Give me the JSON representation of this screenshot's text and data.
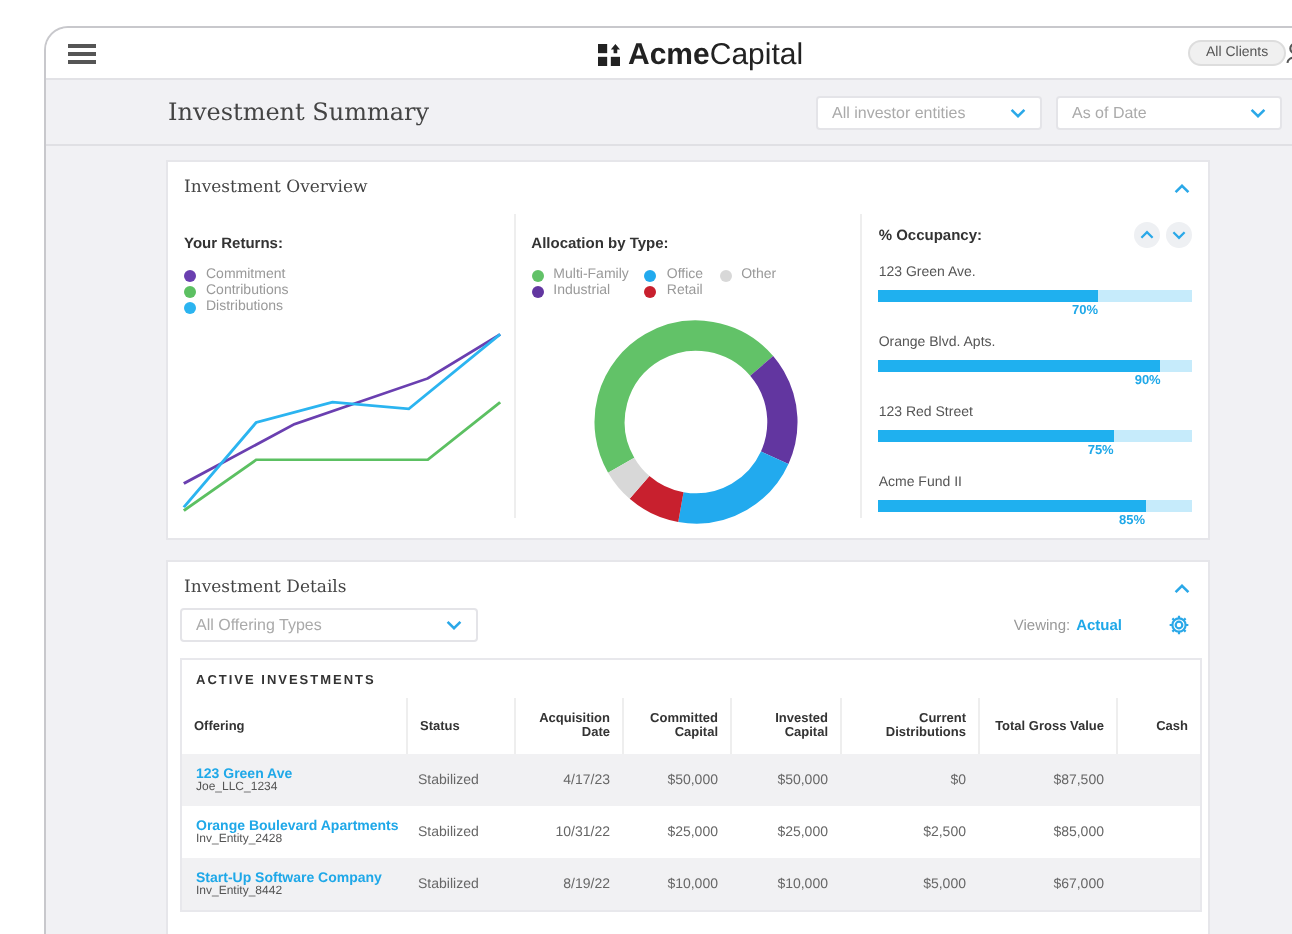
{
  "header": {
    "logo_bold": "Acme",
    "logo_light": "Capital",
    "client_filter": "All Clients"
  },
  "subheader": {
    "title": "Investment Summary",
    "filters": [
      {
        "placeholder": "All investor entities"
      },
      {
        "placeholder": "As of Date"
      }
    ]
  },
  "overview": {
    "title": "Investment Overview",
    "returns": {
      "title": "Your Returns:",
      "legend": [
        {
          "label": "Commitment",
          "color": "#6a3fb0"
        },
        {
          "label": "Contributions",
          "color": "#5cc062"
        },
        {
          "label": "Distributions",
          "color": "#2bb4f0"
        }
      ]
    },
    "allocation": {
      "title": "Allocation by Type:",
      "legend": [
        {
          "label": "Multi-Family",
          "color": "#62c268"
        },
        {
          "label": "Office",
          "color": "#22aaee"
        },
        {
          "label": "Other",
          "color": "#d8d8d8"
        },
        {
          "label": "Industrial",
          "color": "#6236a0"
        },
        {
          "label": "Retail",
          "color": "#c8202e"
        }
      ]
    },
    "occupancy": {
      "title": "% Occupancy:",
      "items": [
        {
          "name": "123 Green Ave.",
          "level": 0.7,
          "reading": "70%"
        },
        {
          "name": "Orange Blvd. Apts.",
          "level": 0.9,
          "reading": "90%"
        },
        {
          "name": "123 Red Street",
          "level": 0.75,
          "reading": "75%"
        },
        {
          "name": "Acme Fund II",
          "level": 0.85,
          "reading": "85%"
        }
      ]
    }
  },
  "details": {
    "title": "Investment Details",
    "filter": {
      "placeholder": "All Offering Types"
    },
    "viewing_label": "Viewing:",
    "viewing_value": "Actual",
    "table": {
      "title": "ACTIVE INVESTMENTS",
      "columns": [
        "Offering",
        "Status",
        "Acquisition Date",
        "Committed Capital",
        "Invested Capital",
        "Current Distributions",
        "Total Gross Value",
        "Cash"
      ],
      "rows": [
        {
          "cells": [
            {
              "text": "123 Green Ave",
              "entity": "Joe_LLC_1234"
            },
            {
              "text": "Stabilized"
            },
            {
              "text": "4/17/23"
            },
            {
              "text": "$50,000"
            },
            {
              "text": "$50,000"
            },
            {
              "text": "$0"
            },
            {
              "text": "$87,500"
            }
          ]
        },
        {
          "cells": [
            {
              "text": "Orange Boulevard Apartments",
              "entity": "Inv_Entity_2428"
            },
            {
              "text": "Stabilized"
            },
            {
              "text": "10/31/22"
            },
            {
              "text": "$25,000"
            },
            {
              "text": "$25,000"
            },
            {
              "text": "$2,500"
            },
            {
              "text": "$85,000"
            }
          ]
        },
        {
          "cells": [
            {
              "text": "Start-Up Software Company",
              "entity": "Inv_Entity_8442"
            },
            {
              "text": "Stabilized"
            },
            {
              "text": "8/19/22"
            },
            {
              "text": "$10,000"
            },
            {
              "text": "$10,000"
            },
            {
              "text": "$5,000"
            },
            {
              "text": "$67,000"
            }
          ]
        }
      ]
    }
  }
}
